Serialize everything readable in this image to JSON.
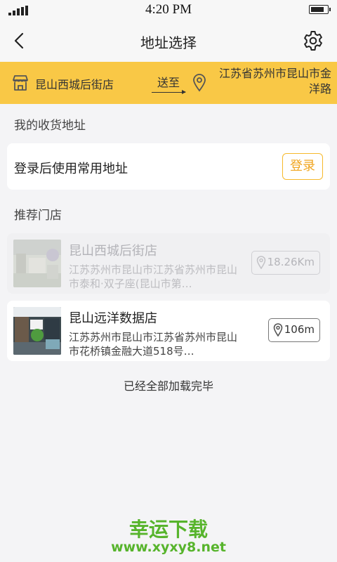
{
  "status_bar": {
    "time": "4:20 PM"
  },
  "header": {
    "title": "地址选择"
  },
  "current_store": {
    "name": "昆山西城后街店",
    "deliver_label": "送至",
    "address": "江苏省苏州市昆山市金洋路"
  },
  "my_address": {
    "section_title": "我的收货地址",
    "prompt": "登录后使用常用地址",
    "login_label": "登录"
  },
  "recommended": {
    "section_title": "推荐门店",
    "stores": [
      {
        "name": "昆山西城后街店",
        "address": "江苏苏州市昆山市江苏省苏州市昆山市泰和·双子座(昆山市第…",
        "distance": "18.26Km"
      },
      {
        "name": "昆山远洋数据店",
        "address": "江苏苏州市昆山市江苏省苏州市昆山市花桥镇金融大道518号…",
        "distance": "106m"
      }
    ],
    "end_text": "已经全部加载完毕"
  },
  "watermark": {
    "title": "幸运下载",
    "url": "www.xyxy8.net"
  },
  "colors": {
    "accent": "#f9c846",
    "login_border": "#f6b92b",
    "watermark": "#57b42c"
  }
}
